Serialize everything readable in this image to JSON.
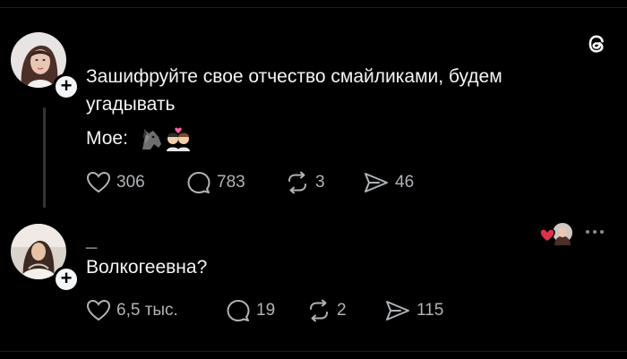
{
  "post": {
    "text_line1": "Зашифруйте свое отчество смайликами, будем",
    "text_line2": "угадывать",
    "mine_label": "Мое:",
    "emoji": [
      "horse-face-emoji",
      "kissing-couple-emoji"
    ],
    "actions": {
      "likes": "306",
      "comments": "783",
      "reposts": "3",
      "shares": "46"
    }
  },
  "reply": {
    "username": "_",
    "text": "Волкогеевна?",
    "actions": {
      "likes": "6,5 тыс.",
      "comments": "19",
      "reposts": "2",
      "shares": "115"
    },
    "liked_by_author": true
  },
  "colors": {
    "background": "#000000",
    "text": "#f3f5f7",
    "muted": "#b0b3b6",
    "heart": "#e0314b"
  }
}
